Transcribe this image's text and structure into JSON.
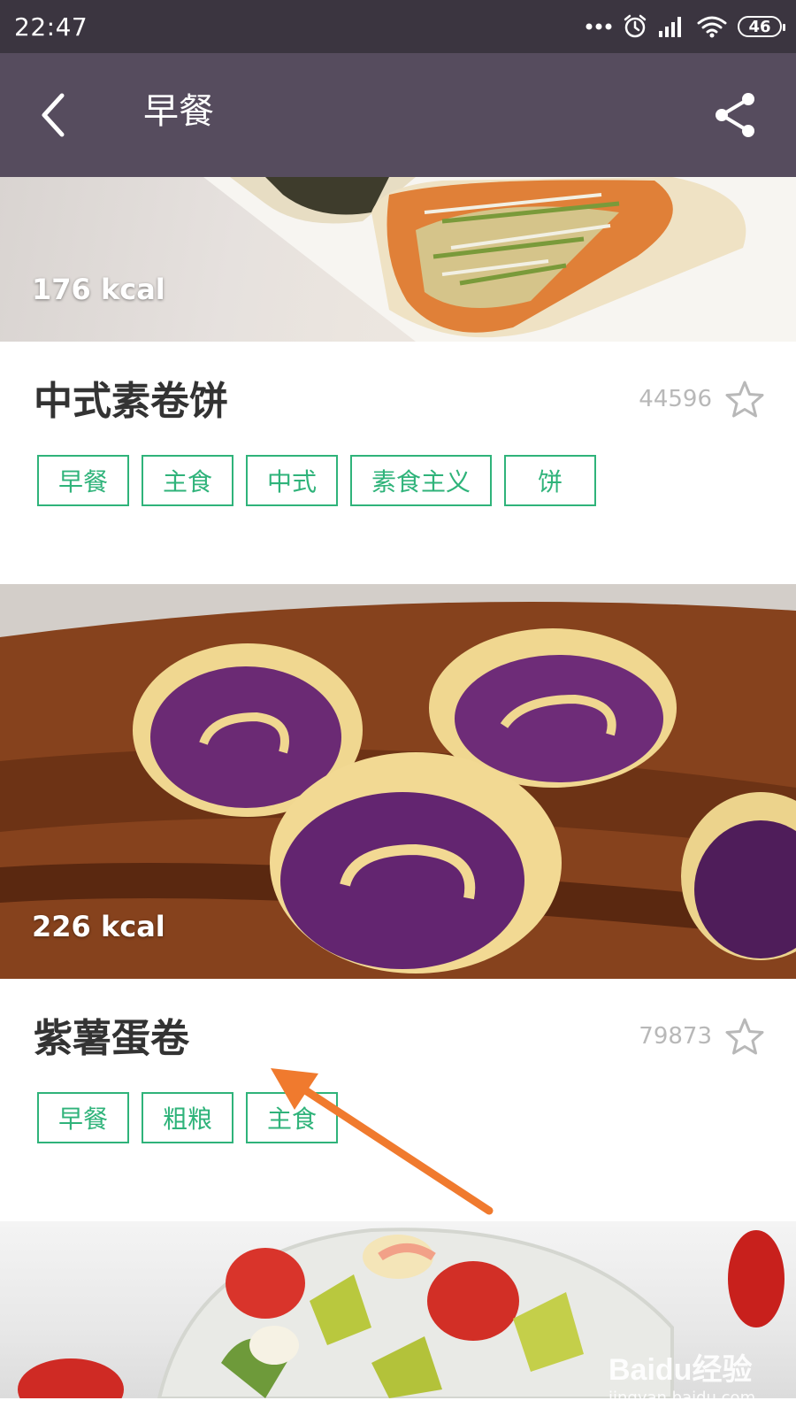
{
  "status_bar": {
    "time": "22:47",
    "battery": "46",
    "icons": [
      "more-dots-icon",
      "alarm-icon",
      "signal-icon",
      "wifi-icon",
      "battery-icon"
    ]
  },
  "app_bar": {
    "title": "早餐",
    "back_icon": "back-arrow-icon",
    "share_icon": "share-icon"
  },
  "recipes": [
    {
      "kcal": "176 kcal",
      "title": "中式素卷饼",
      "views": "44596",
      "tags": [
        "早餐",
        "主食",
        "中式",
        "素食主义",
        "饼"
      ]
    },
    {
      "kcal": "226 kcal",
      "title": "紫薯蛋卷",
      "views": "79873",
      "tags": [
        "早餐",
        "粗粮",
        "主食"
      ]
    }
  ],
  "watermark": {
    "logo": "Baidu经验",
    "url": "jingyan.baidu.com"
  },
  "colors": {
    "status_bar": "#3b3540",
    "app_bar": "#564c5e",
    "tag_green": "#2fb37a",
    "annotation_arrow": "#f07a2e"
  }
}
